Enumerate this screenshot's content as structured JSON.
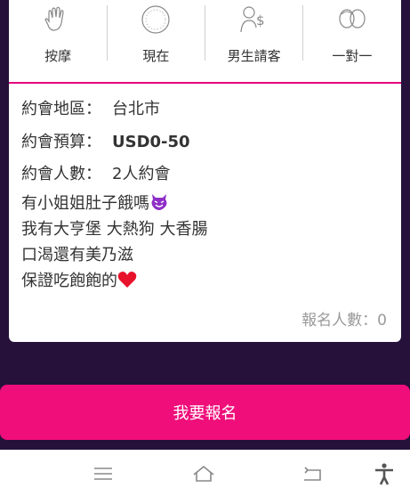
{
  "features": [
    {
      "label": "按摩",
      "icon": "wave-hand-icon"
    },
    {
      "label": "現在",
      "icon": "clock-icon"
    },
    {
      "label": "男生請客",
      "icon": "male-pays-icon"
    },
    {
      "label": "一對一",
      "icon": "couple-faces-icon"
    }
  ],
  "info": {
    "location_label": "約會地區：",
    "location_value": "台北市",
    "budget_label": "約會預算：",
    "budget_value": "USD0-50",
    "people_label": "約會人數：",
    "people_value": "2人約會"
  },
  "description": [
    "有小姐姐肚子餓嗎",
    "我有大亨堡 大熱狗 大香腸",
    "口渴還有美乃滋",
    "保證吃飽飽的"
  ],
  "signup_count": "報名人數：0",
  "cta_label": "我要報名",
  "nav": {
    "menu_icon": "menu-icon",
    "home_icon": "home-icon",
    "back_icon": "back-icon",
    "accessibility_icon": "accessibility-icon"
  },
  "colors": {
    "accent": "#ef0e7a",
    "background": "#25113a"
  }
}
